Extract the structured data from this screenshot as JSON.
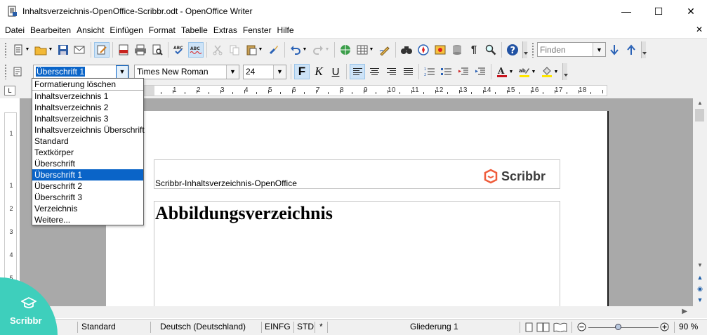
{
  "window": {
    "title": "Inhaltsverzeichnis-OpenOffice-Scribbr.odt - OpenOffice Writer",
    "controls": [
      "—",
      "☐",
      "✕"
    ],
    "close_doc": "✕"
  },
  "menu": [
    "Datei",
    "Bearbeiten",
    "Ansicht",
    "Einfügen",
    "Format",
    "Tabelle",
    "Extras",
    "Fenster",
    "Hilfe"
  ],
  "toolbar": {
    "find_placeholder": "Finden"
  },
  "formatting": {
    "style_value": "Überschrift 1",
    "font_value": "Times New Roman",
    "size_value": "24",
    "bold": "F",
    "italic": "K",
    "underline": "U"
  },
  "style_dropdown": {
    "options": [
      "Formatierung löschen",
      "Inhaltsverzeichnis 1",
      "Inhaltsverzeichnis 2",
      "Inhaltsverzeichnis 3",
      "Inhaltsverzeichnis Überschrift",
      "Standard",
      "Textkörper",
      "Überschrift",
      "Überschrift 1",
      "Überschrift 2",
      "Überschrift 3",
      "Verzeichnis",
      "Weitere..."
    ],
    "selected": "Überschrift 1"
  },
  "ruler": {
    "corner": "L",
    "h_numbers": [
      "1",
      "2",
      "3",
      "4",
      "5",
      "6",
      "7",
      "8",
      "9",
      "10",
      "11",
      "12",
      "13",
      "14",
      "15",
      "16",
      "17",
      "18"
    ],
    "v_numbers": [
      "1",
      "1",
      "2",
      "3",
      "4",
      "5"
    ]
  },
  "document": {
    "header_text": "Scribbr-Inhaltsverzeichnis-OpenOffice",
    "logo_text": "Scribbr",
    "heading": "Abbildungsverzeichnis"
  },
  "statusbar": {
    "page_style": "Standard",
    "language": "Deutsch (Deutschland)",
    "insert_mode": "EINFG",
    "selection_mode": "STD",
    "modified": "*",
    "outline": "Gliederung 1",
    "zoom": "90 %"
  },
  "badge": {
    "label": "Scribbr"
  },
  "colors": {
    "accent": "#0a64c8",
    "logo": "#ef5b3a",
    "badge": "#3ecfbc"
  }
}
